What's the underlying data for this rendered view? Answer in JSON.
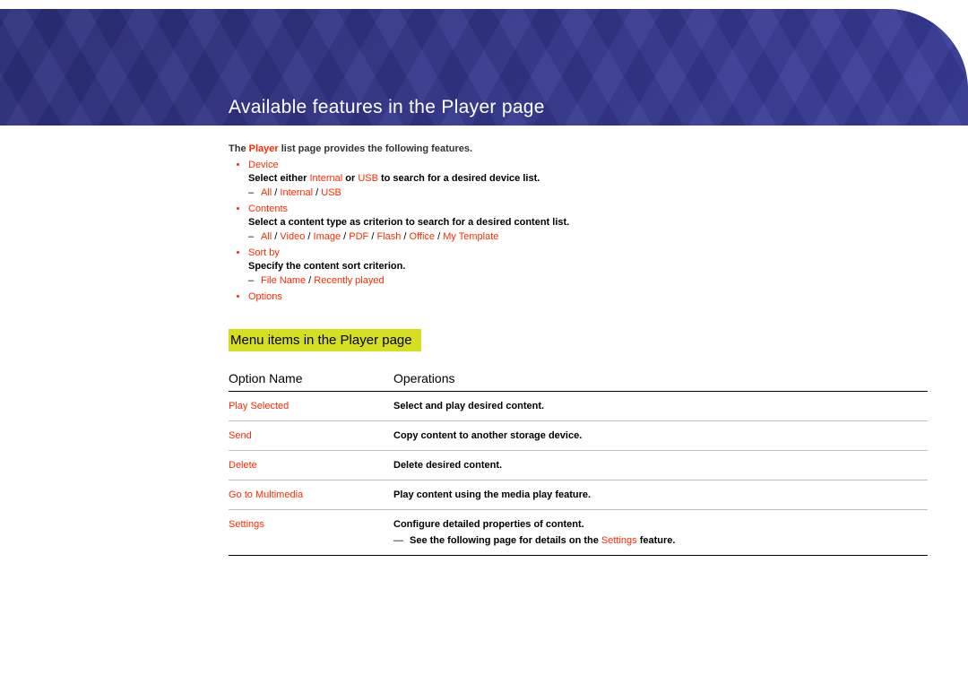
{
  "page_title": "Available features in the Player page",
  "intro": {
    "pre": "The ",
    "hl": "Player",
    "post": " list page provides the following features."
  },
  "features": [
    {
      "name": "Device",
      "desc": {
        "pre": "Select either ",
        "hl1": "Internal",
        "mid": " or ",
        "hl2": "USB",
        "post": " to search for a desired device list."
      },
      "sub": {
        "items": [
          "All",
          "Internal",
          "USB"
        ]
      }
    },
    {
      "name": "Contents",
      "desc": {
        "text": "Select a content type as criterion to search for a desired content list."
      },
      "sub": {
        "items": [
          "All",
          "Video",
          "Image",
          "PDF",
          "Flash",
          "Office",
          "My Template"
        ]
      }
    },
    {
      "name": "Sort by",
      "desc": {
        "text": "Specify the content sort criterion."
      },
      "sub": {
        "items": [
          "File Name",
          "Recently played"
        ]
      }
    },
    {
      "name": "Options"
    }
  ],
  "subsection": "Menu items in the Player page",
  "table": {
    "headers": [
      "Option Name",
      "Operations"
    ],
    "rows": [
      {
        "name": "Play Selected",
        "op": "Select and play desired content."
      },
      {
        "name": "Send",
        "op": "Copy content to another storage device."
      },
      {
        "name": "Delete",
        "op": "Delete desired content."
      },
      {
        "name": "Go to Multimedia",
        "op": "Play content using the media play feature."
      },
      {
        "name": "Settings",
        "op": "Configure detailed properties of content.",
        "note": {
          "pre": "See the following page for details on the ",
          "hl": "Settings",
          "post": " feature."
        }
      }
    ]
  }
}
